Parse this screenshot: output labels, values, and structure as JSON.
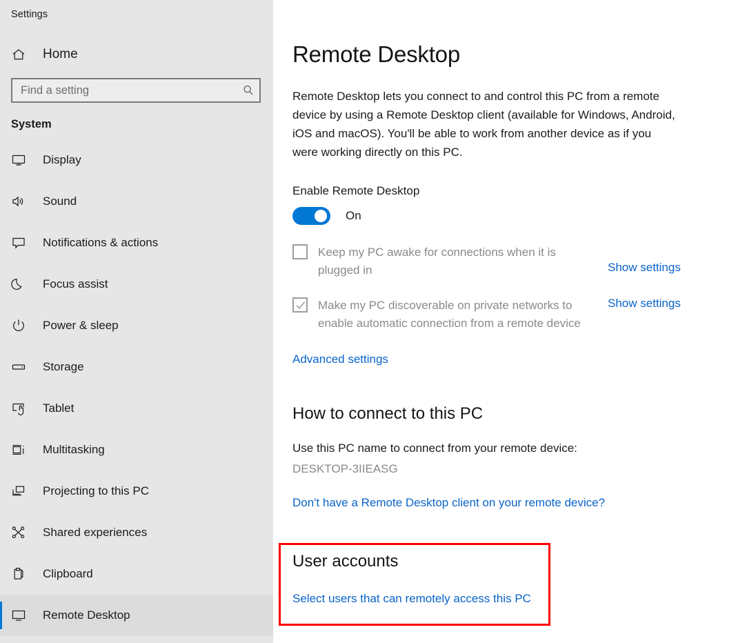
{
  "window": {
    "title": "Settings"
  },
  "sidebar": {
    "home": {
      "label": "Home",
      "icon": "home-icon"
    },
    "search": {
      "placeholder": "Find a setting",
      "value": "",
      "icon": "search-icon"
    },
    "group_header": "System",
    "items": [
      {
        "label": "Display",
        "icon": "monitor-icon",
        "selected": false
      },
      {
        "label": "Sound",
        "icon": "speaker-icon",
        "selected": false
      },
      {
        "label": "Notifications & actions",
        "icon": "notification-icon",
        "selected": false
      },
      {
        "label": "Focus assist",
        "icon": "moon-icon",
        "selected": false
      },
      {
        "label": "Power & sleep",
        "icon": "power-icon",
        "selected": false
      },
      {
        "label": "Storage",
        "icon": "storage-icon",
        "selected": false
      },
      {
        "label": "Tablet",
        "icon": "tablet-icon",
        "selected": false
      },
      {
        "label": "Multitasking",
        "icon": "multitasking-icon",
        "selected": false
      },
      {
        "label": "Projecting to this PC",
        "icon": "projecting-icon",
        "selected": false
      },
      {
        "label": "Shared experiences",
        "icon": "share-icon",
        "selected": false
      },
      {
        "label": "Clipboard",
        "icon": "clipboard-icon",
        "selected": false
      },
      {
        "label": "Remote Desktop",
        "icon": "remote-desktop-icon",
        "selected": true
      }
    ]
  },
  "main": {
    "page_title": "Remote Desktop",
    "intro": "Remote Desktop lets you connect to and control this PC from a remote device by using a Remote Desktop client (available for Windows, Android, iOS and macOS). You'll be able to work from another device as if you were working directly on this PC.",
    "enable": {
      "label": "Enable Remote Desktop",
      "toggle_state": "On",
      "toggle_on": true
    },
    "checkboxes": [
      {
        "label": "Keep my PC awake for connections when it is plugged in",
        "checked": false,
        "disabled": true,
        "action_label": "Show settings"
      },
      {
        "label": "Make my PC discoverable on private networks to enable automatic connection from a remote device",
        "checked": true,
        "disabled": true,
        "action_label": "Show settings"
      }
    ],
    "advanced_settings_label": "Advanced settings",
    "how_to_connect": {
      "heading": "How to connect to this PC",
      "instruction": "Use this PC name to connect from your remote device:",
      "pc_name": "DESKTOP-3IIEASG",
      "client_link": "Don't have a Remote Desktop client on your remote device?"
    },
    "user_accounts": {
      "heading": "User accounts",
      "link": "Select users that can remotely access this PC"
    }
  },
  "colors": {
    "accent": "#0078d4",
    "link": "#0a64c8",
    "highlight": "#ff0000",
    "sidebar_bg": "#e6e6e6",
    "disabled_text": "#8a8a8a"
  }
}
